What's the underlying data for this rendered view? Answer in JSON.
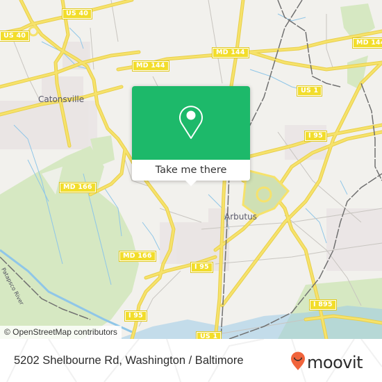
{
  "map": {
    "place_labels": [
      "Catonsville",
      "Arbutus"
    ],
    "river_label": "Patapsco River",
    "road_shields": [
      "US 40",
      "US 40",
      "MD 144",
      "MD 144",
      "MD 144",
      "US 1",
      "I 95",
      "MD 166",
      "MD 166",
      "I 95",
      "I 95",
      "I 895",
      "US 1"
    ],
    "attribution": "© OpenStreetMap contributors",
    "colors": {
      "background": "#f2f1ed",
      "road": "#f6e26b",
      "park": "#d4e6bf",
      "water": "#8fc6e8",
      "rail": "#707070"
    }
  },
  "popup": {
    "icon": "map-pin-icon",
    "button_label": "Take me there",
    "color": "#1db96a"
  },
  "footer": {
    "address": "5202 Shelbourne Rd, Washington / Baltimore",
    "brand": "moovit",
    "brand_icon": "moovit-smiley-pin-icon",
    "brand_color": "#f0643c"
  }
}
